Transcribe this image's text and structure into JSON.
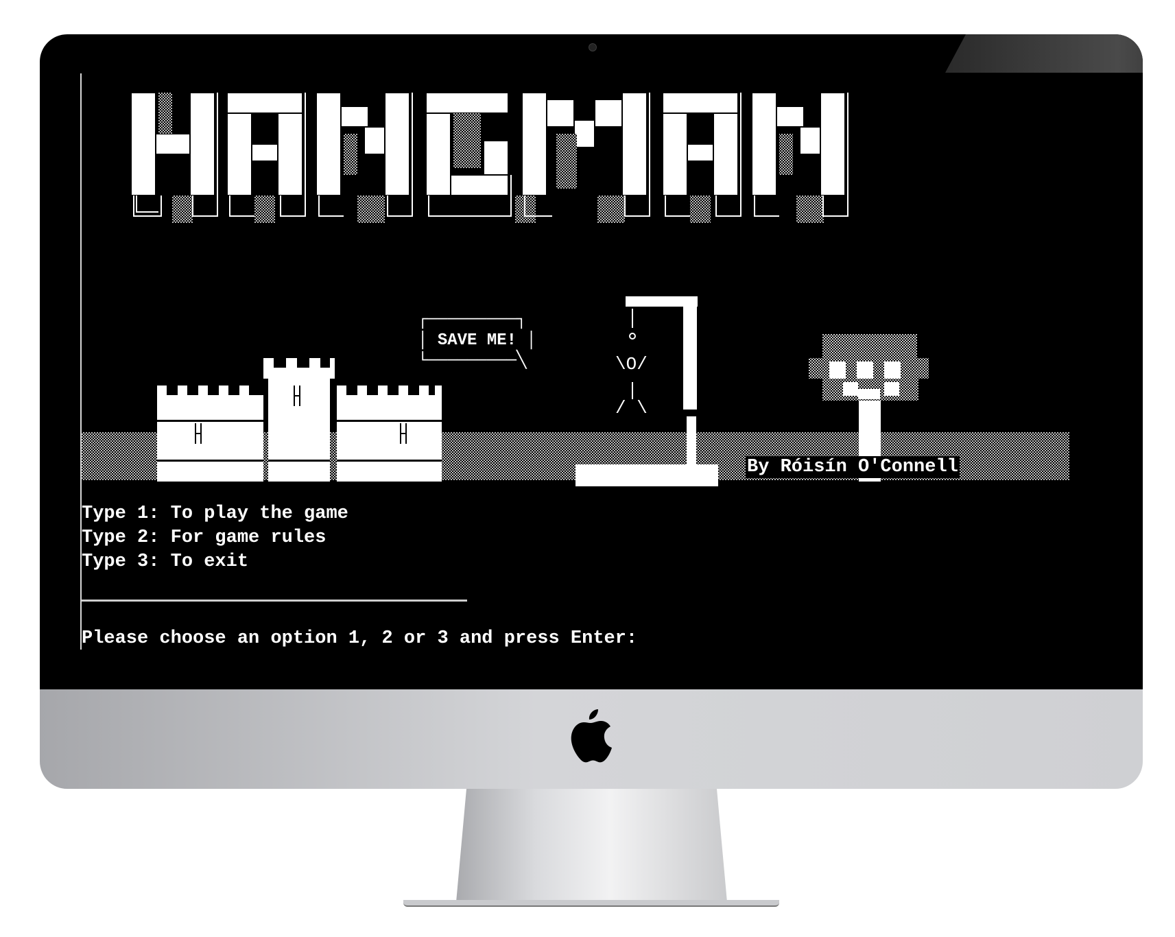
{
  "app": {
    "title_art_text": "HANGMAN",
    "speech_bubble": "SAVE ME!",
    "byline": "By Róisín O'Connell"
  },
  "menu": {
    "options": [
      "Type 1: To play the game",
      "Type 2: For game rules",
      "Type 3: To exit"
    ],
    "prompt": "Please choose an option 1, 2 or 3 and press Enter:"
  },
  "icons": {
    "device_logo": "apple-icon",
    "camera": "camera-icon"
  },
  "colors": {
    "terminal_bg": "#000000",
    "terminal_fg": "#ffffff",
    "bezel": "#000000",
    "chin": "#cfd0d3"
  }
}
